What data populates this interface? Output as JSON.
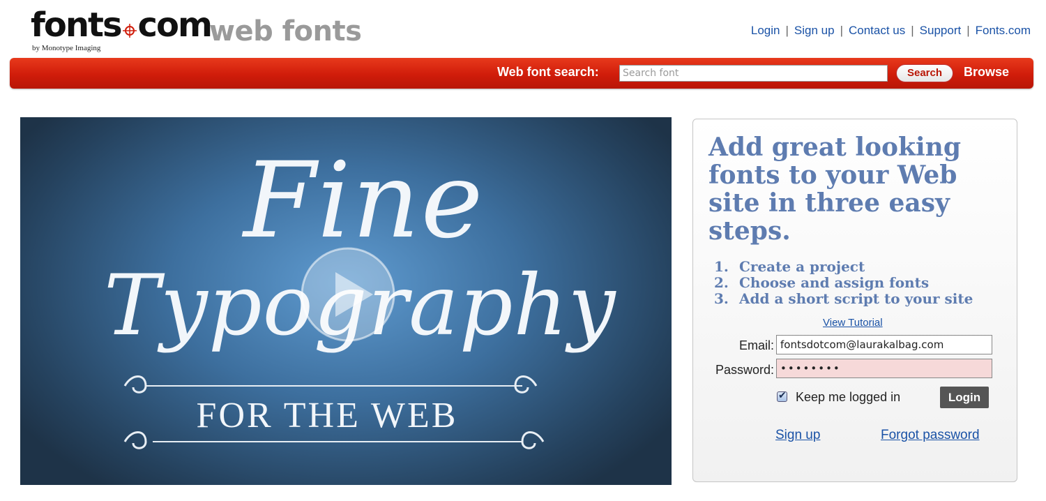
{
  "logo": {
    "brand_left": "fonts",
    "brand_right": "com",
    "tagline": "by Monotype Imaging",
    "product": "web fonts"
  },
  "top_nav": {
    "links": [
      "Login",
      "Sign up",
      "Contact us",
      "Support",
      "Fonts.com"
    ]
  },
  "search_bar": {
    "label": "Web font search:",
    "placeholder": "Search font",
    "search_button": "Search",
    "browse_link": "Browse"
  },
  "video": {
    "title_line1": "Fine",
    "title_line2": "Typography",
    "subtitle": "FOR THE WEB",
    "play_icon": "play-icon"
  },
  "promo": {
    "headline": "Add great looking fonts to your Web site in three easy steps.",
    "steps": [
      {
        "num": "1.",
        "text": "Create a project"
      },
      {
        "num": "2.",
        "text": "Choose and assign fonts"
      },
      {
        "num": "3.",
        "text": "Add a short script to your site"
      }
    ],
    "tutorial_link": "View Tutorial"
  },
  "login_form": {
    "email_label": "Email:",
    "email_value": "fontsdotcom@laurakalbag.com",
    "password_label": "Password:",
    "password_value": "••••••••",
    "keep_logged_in_label": "Keep me logged in",
    "keep_logged_in_checked": true,
    "login_button": "Login",
    "signup_link": "Sign up",
    "forgot_link": "Forgot password"
  },
  "colors": {
    "brand_red": "#d01c0a",
    "link_blue": "#1a52a6",
    "headline_blue": "#5e7cb0",
    "password_bg": "#f6d9d9"
  }
}
